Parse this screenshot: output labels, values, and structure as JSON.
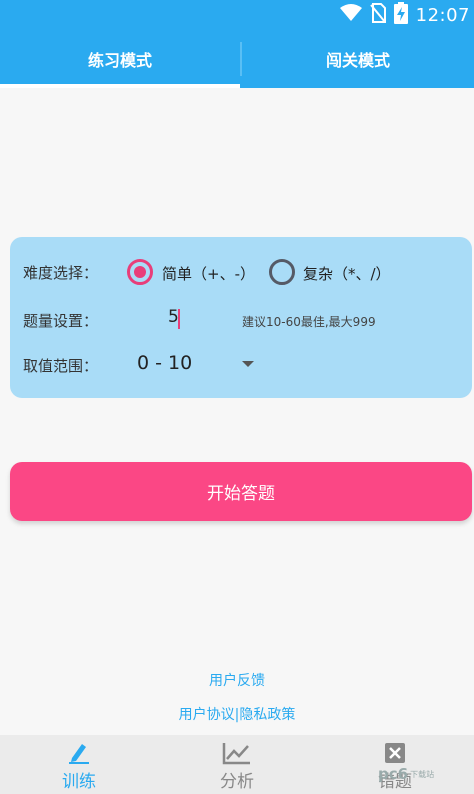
{
  "status_bar": {
    "time": "12:07",
    "icons": [
      "wifi-icon",
      "no-sim-icon",
      "battery-charging-icon"
    ]
  },
  "tabs": [
    {
      "label": "练习模式",
      "active": true
    },
    {
      "label": "闯关模式",
      "active": false
    }
  ],
  "settings": {
    "difficulty_label": "难度选择：",
    "options": [
      {
        "label": "简单（+、-）",
        "selected": true
      },
      {
        "label": "复杂（*、/）",
        "selected": false
      }
    ],
    "quantity_label": "题量设置：",
    "quantity_value": "5",
    "quantity_hint": "建议10-60最佳,最大999",
    "range_label": "取值范围：",
    "range_value": "0 - 10"
  },
  "start_button": {
    "label": "开始答题"
  },
  "links": {
    "feedback": "用户反馈",
    "policy": "用户协议|隐私政策"
  },
  "bottom_nav": [
    {
      "label": "训练",
      "icon": "pencil-icon",
      "active": true
    },
    {
      "label": "分析",
      "icon": "chart-icon",
      "active": false
    },
    {
      "label": "错题",
      "icon": "close-box-icon",
      "active": false
    }
  ],
  "watermark": {
    "text": "pc6",
    "sub": "下载站"
  },
  "colors": {
    "primary": "#2aaaf0",
    "accent": "#fb4785",
    "radio_selected": "#e83e7a",
    "panel": "#a9dcf7"
  }
}
